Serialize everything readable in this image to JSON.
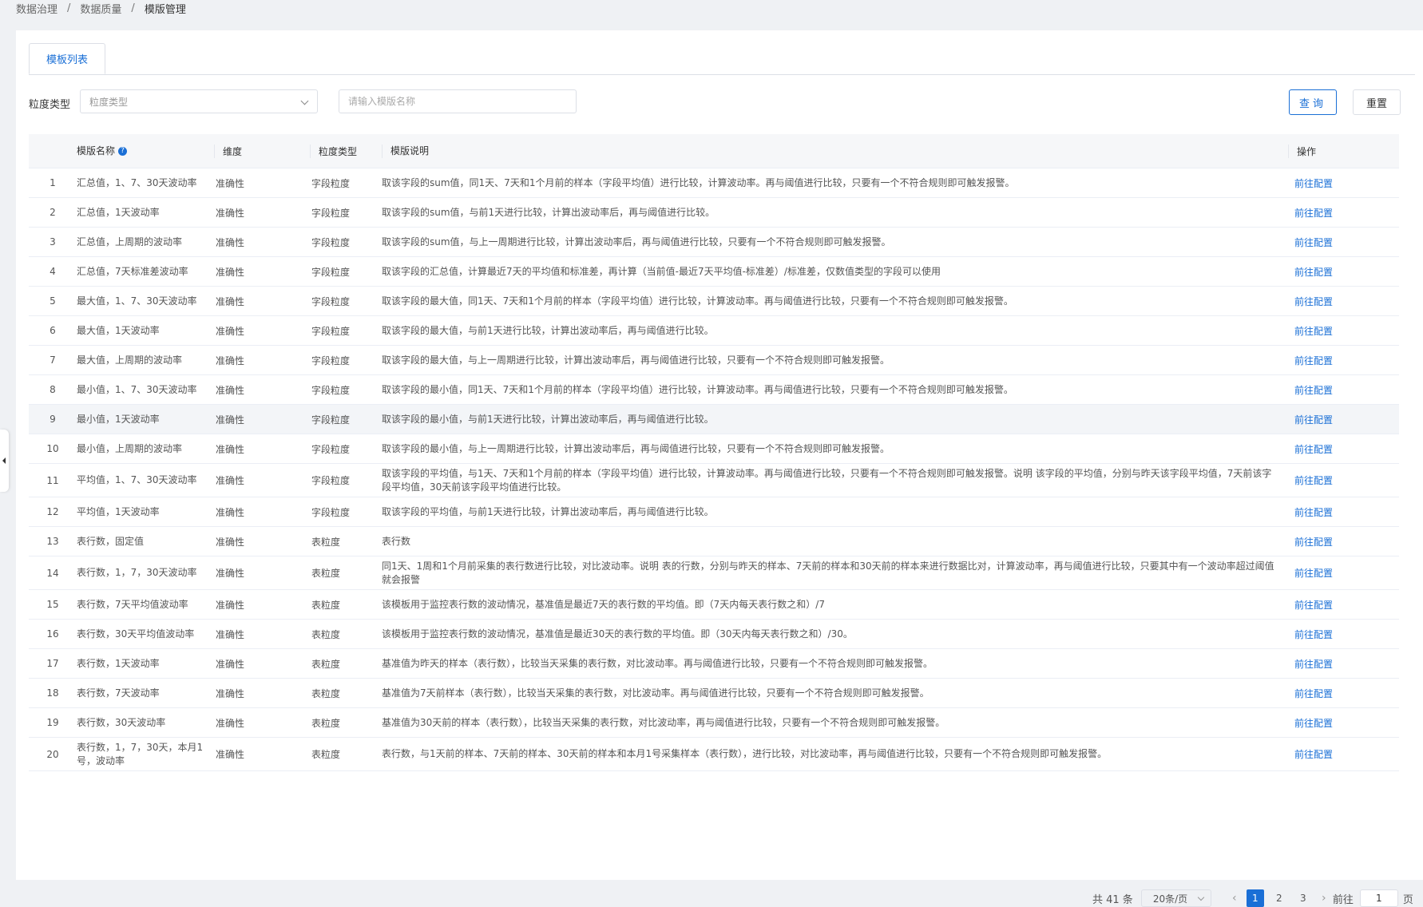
{
  "breadcrumb": [
    "数据治理",
    "数据质量",
    "模版管理"
  ],
  "tabs": [
    {
      "label": "模板列表",
      "active": true
    }
  ],
  "filter": {
    "granularity_label": "粒度类型",
    "granularity_placeholder": "粒度类型",
    "name_placeholder": "请输入模版名称",
    "query_label": "查询",
    "reset_label": "重置"
  },
  "table": {
    "headers": {
      "name": "模版名称",
      "dimension": "维度",
      "granularity": "粒度类型",
      "description": "模版说明",
      "action": "操作"
    },
    "action_label": "前往配置",
    "rows": [
      {
        "index": "1",
        "name": "汇总值，1、7、30天波动率",
        "dimension": "准确性",
        "granularity": "字段粒度",
        "description": "取该字段的sum值，同1天、7天和1个月前的样本（字段平均值）进行比较，计算波动率。再与阈值进行比较，只要有一个不符合规则即可触发报警。"
      },
      {
        "index": "2",
        "name": "汇总值，1天波动率",
        "dimension": "准确性",
        "granularity": "字段粒度",
        "description": "取该字段的sum值，与前1天进行比较，计算出波动率后，再与阈值进行比较。"
      },
      {
        "index": "3",
        "name": "汇总值，上周期的波动率",
        "dimension": "准确性",
        "granularity": "字段粒度",
        "description": "取该字段的sum值，与上一周期进行比较，计算出波动率后，再与阈值进行比较，只要有一个不符合规则即可触发报警。"
      },
      {
        "index": "4",
        "name": "汇总值，7天标准差波动率",
        "dimension": "准确性",
        "granularity": "字段粒度",
        "description": "取该字段的汇总值，计算最近7天的平均值和标准差，再计算（当前值-最近7天平均值-标准差）/标准差，仅数值类型的字段可以使用"
      },
      {
        "index": "5",
        "name": "最大值，1、7、30天波动率",
        "dimension": "准确性",
        "granularity": "字段粒度",
        "description": "取该字段的最大值，同1天、7天和1个月前的样本（字段平均值）进行比较，计算波动率。再与阈值进行比较，只要有一个不符合规则即可触发报警。"
      },
      {
        "index": "6",
        "name": "最大值，1天波动率",
        "dimension": "准确性",
        "granularity": "字段粒度",
        "description": "取该字段的最大值，与前1天进行比较，计算出波动率后，再与阈值进行比较。"
      },
      {
        "index": "7",
        "name": "最大值，上周期的波动率",
        "dimension": "准确性",
        "granularity": "字段粒度",
        "description": "取该字段的最大值，与上一周期进行比较，计算出波动率后，再与阈值进行比较，只要有一个不符合规则即可触发报警。"
      },
      {
        "index": "8",
        "name": "最小值，1、7、30天波动率",
        "dimension": "准确性",
        "granularity": "字段粒度",
        "description": "取该字段的最小值，同1天、7天和1个月前的样本（字段平均值）进行比较，计算波动率。再与阈值进行比较，只要有一个不符合规则即可触发报警。"
      },
      {
        "index": "9",
        "name": "最小值，1天波动率",
        "dimension": "准确性",
        "granularity": "字段粒度",
        "description": "取该字段的最小值，与前1天进行比较，计算出波动率后，再与阈值进行比较。"
      },
      {
        "index": "10",
        "name": "最小值，上周期的波动率",
        "dimension": "准确性",
        "granularity": "字段粒度",
        "description": "取该字段的最小值，与上一周期进行比较，计算出波动率后，再与阈值进行比较，只要有一个不符合规则即可触发报警。"
      },
      {
        "index": "11",
        "name": "平均值，1、7、30天波动率",
        "dimension": "准确性",
        "granularity": "字段粒度",
        "description": "取该字段的平均值，与1天、7天和1个月前的样本（字段平均值）进行比较，计算波动率。再与阈值进行比较，只要有一个不符合规则即可触发报警。说明 该字段的平均值，分别与昨天该字段平均值，7天前该字段平均值，30天前该字段平均值进行比较。"
      },
      {
        "index": "12",
        "name": "平均值，1天波动率",
        "dimension": "准确性",
        "granularity": "字段粒度",
        "description": "取该字段的平均值，与前1天进行比较，计算出波动率后，再与阈值进行比较。"
      },
      {
        "index": "13",
        "name": "表行数，固定值",
        "dimension": "准确性",
        "granularity": "表粒度",
        "description": "表行数"
      },
      {
        "index": "14",
        "name": "表行数，1，7，30天波动率",
        "dimension": "准确性",
        "granularity": "表粒度",
        "description": "同1天、1周和1个月前采集的表行数进行比较，对比波动率。说明 表的行数，分别与昨天的样本、7天前的样本和30天前的样本来进行数据比对，计算波动率，再与阈值进行比较，只要其中有一个波动率超过阈值就会报警"
      },
      {
        "index": "15",
        "name": "表行数，7天平均值波动率",
        "dimension": "准确性",
        "granularity": "表粒度",
        "description": "该模板用于监控表行数的波动情况，基准值是最近7天的表行数的平均值。即（7天内每天表行数之和）/7"
      },
      {
        "index": "16",
        "name": "表行数，30天平均值波动率",
        "dimension": "准确性",
        "granularity": "表粒度",
        "description": "该模板用于监控表行数的波动情况，基准值是最近30天的表行数的平均值。即（30天内每天表行数之和）/30。"
      },
      {
        "index": "17",
        "name": "表行数，1天波动率",
        "dimension": "准确性",
        "granularity": "表粒度",
        "description": "基准值为昨天的样本（表行数），比较当天采集的表行数，对比波动率。再与阈值进行比较，只要有一个不符合规则即可触发报警。"
      },
      {
        "index": "18",
        "name": "表行数，7天波动率",
        "dimension": "准确性",
        "granularity": "表粒度",
        "description": "基准值为7天前样本（表行数），比较当天采集的表行数，对比波动率。再与阈值进行比较，只要有一个不符合规则即可触发报警。"
      },
      {
        "index": "19",
        "name": "表行数，30天波动率",
        "dimension": "准确性",
        "granularity": "表粒度",
        "description": "基准值为30天前的样本（表行数），比较当天采集的表行数，对比波动率，再与阈值进行比较，只要有一个不符合规则即可触发报警。"
      },
      {
        "index": "20",
        "name": "表行数，1，7，30天，本月1号，波动率",
        "dimension": "准确性",
        "granularity": "表粒度",
        "description": "表行数，与1天前的样本、7天前的样本、30天前的样本和本月1号采集样本（表行数），进行比较，对比波动率，再与阈值进行比较，只要有一个不符合规则即可触发报警。"
      }
    ]
  },
  "pagination": {
    "total_text": "共 41 条",
    "page_size": "20条/页",
    "pages": [
      "1",
      "2",
      "3"
    ],
    "current_page": "1",
    "goto_label": "前往",
    "goto_value": "1",
    "page_unit": "页"
  },
  "colors": {
    "accent": "#1a6fd6",
    "header_bg": "#f6f7f9",
    "page_bg": "#eff1f4"
  }
}
